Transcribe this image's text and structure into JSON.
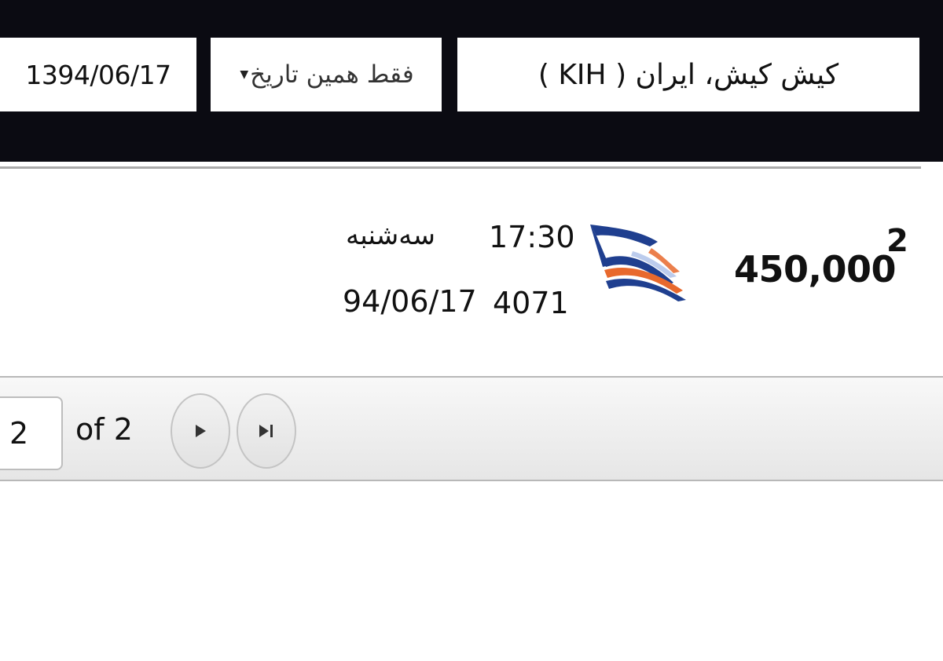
{
  "search": {
    "origin": "کیش کیش، ایران ( KIH )",
    "date_mode": "فقط همین تاریخ",
    "date": "1394/06/17"
  },
  "results": [
    {
      "index": "2",
      "price": "450,000",
      "airline_logo": "airline-flag-logo",
      "departure_time": "17:30",
      "flight_number": "4071",
      "weekday": "سه‌شنبه",
      "flight_date": "94/06/17"
    }
  ],
  "pager": {
    "current_page": "2",
    "of_label": "of 2",
    "next_icon": "play-icon",
    "last_icon": "skip-to-end-icon"
  },
  "colors": {
    "header_bg": "#0b0b12",
    "logo_blue": "#1f3f8f",
    "logo_orange": "#e8692d"
  }
}
